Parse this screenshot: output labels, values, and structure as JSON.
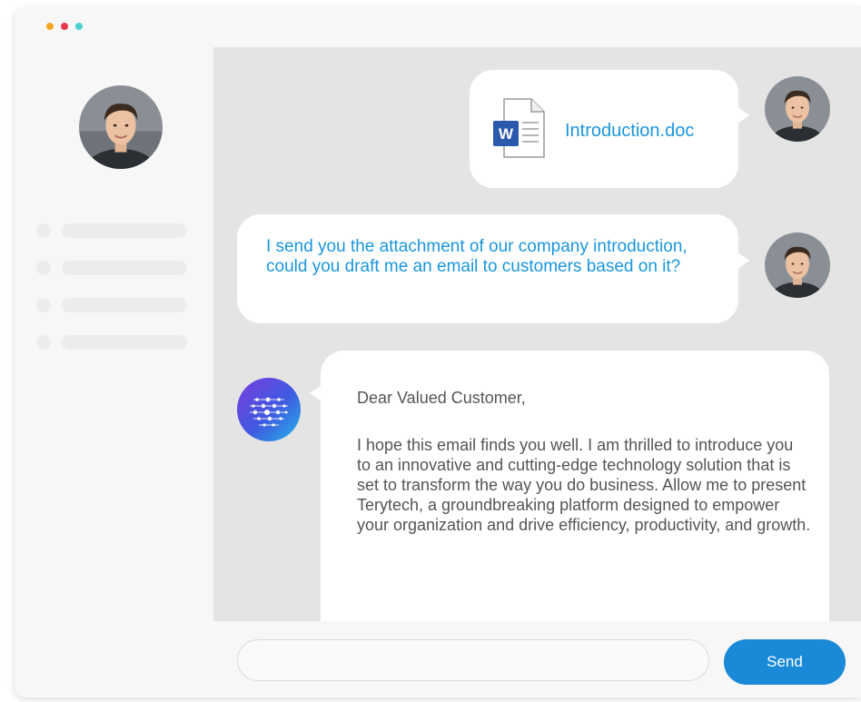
{
  "window": {
    "controls": [
      "orange-dot",
      "red-dot",
      "teal-dot"
    ]
  },
  "colors": {
    "accent": "#1a96db",
    "send_button": "#1a8ad8",
    "chat_background": "#e4e4e4",
    "bubble": "#ffffff",
    "body_text": "#555555",
    "word_icon": "#2b5aad"
  },
  "sidebar": {
    "avatar_icon": "user-avatar-icon",
    "placeholder_items": 4
  },
  "messages": [
    {
      "type": "file",
      "sender": "user",
      "file_name": "Introduction.doc",
      "file_icon": "word-document-icon",
      "word_badge": "W"
    },
    {
      "type": "text",
      "sender": "user",
      "text": "I send you the attachment of our company introduction, could you draft me an email to customers based on it?"
    },
    {
      "type": "ai",
      "sender": "assistant",
      "avatar_icon": "ai-bot-icon",
      "greeting": "Dear Valued Customer,",
      "body": "I hope this email finds you well. I am thrilled to introduce you to an innovative and cutting-edge technology solution that is set to transform the way you do business. Allow me to present Terytech, a groundbreaking platform designed to empower your organization and drive efficiency, productivity, and growth."
    }
  ],
  "composer": {
    "placeholder": "",
    "send_label": "Send"
  }
}
